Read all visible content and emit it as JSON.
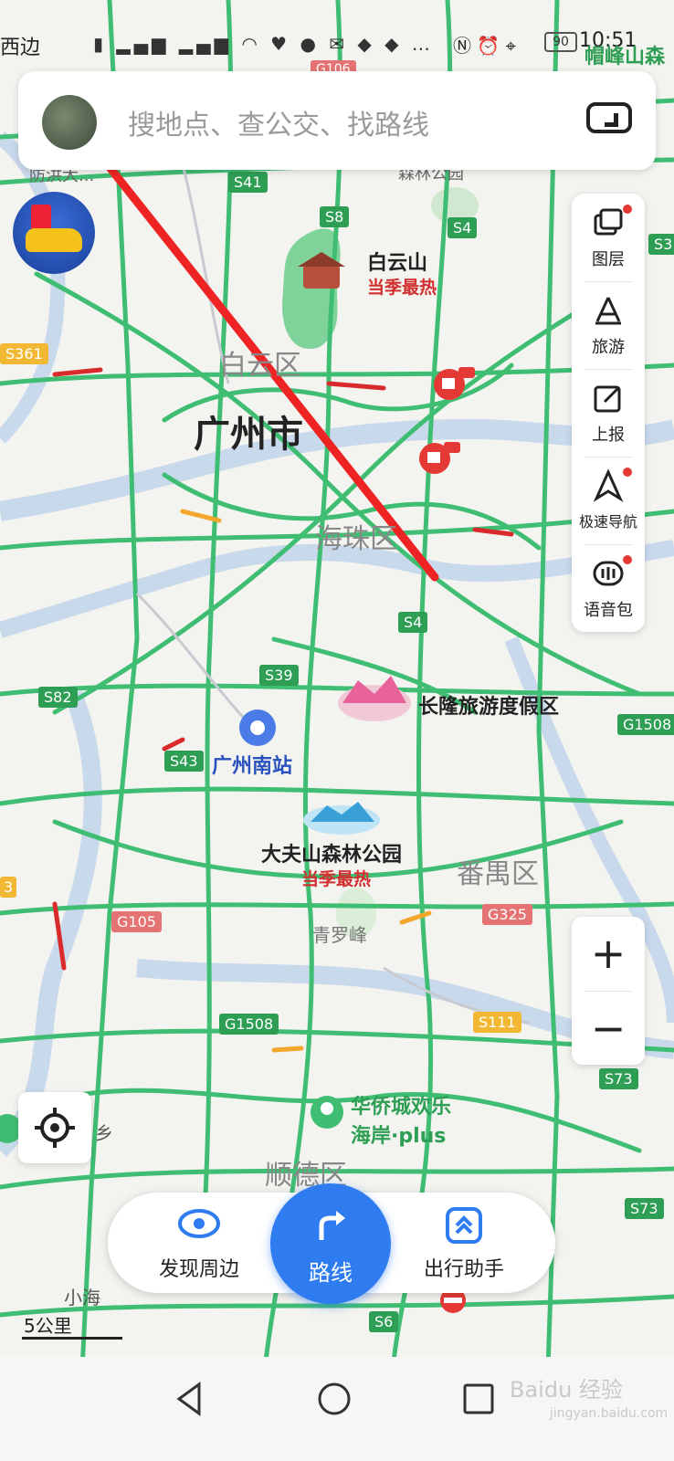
{
  "status_bar": {
    "left_text": "西边",
    "time": "10:51",
    "battery": "90",
    "right_place": "帽峰山森"
  },
  "search": {
    "placeholder": "搜地点、查公交、找路线"
  },
  "side_panel": {
    "items": [
      {
        "label": "图层",
        "icon": "layers-icon",
        "badge": true
      },
      {
        "label": "旅游",
        "icon": "travel-icon",
        "badge": false
      },
      {
        "label": "上报",
        "icon": "report-icon",
        "badge": false
      },
      {
        "label": "极速导航",
        "icon": "navigation-icon",
        "badge": true
      },
      {
        "label": "语音包",
        "icon": "voice-pack-icon",
        "badge": true
      }
    ]
  },
  "zoom": {
    "in": "+",
    "out": "−"
  },
  "bottom_bar": {
    "discover": "发现周边",
    "route": "路线",
    "assistant": "出行助手"
  },
  "scale": {
    "label": "5公里"
  },
  "map": {
    "labels": {
      "baiyunshan": "白云山",
      "baiyunshan_tag": "当季最热",
      "baiyun_district": "白云区",
      "guangzhou": "广州市",
      "haizhu": "海珠区",
      "changlong": "长隆旅游度假区",
      "south_station": "广州南站",
      "dafushan": "大夫山森林公园",
      "dafushan_tag": "当季最热",
      "panyu": "番禺区",
      "qingluofeng": "青罗峰",
      "huaqiao_line1": "华侨城欢乐",
      "huaqiao_line2": "海岸·plus",
      "shunde": "顺德区",
      "xiaohai": "小海",
      "xiang": "乡",
      "fanghong": "防洪大...",
      "senlin_top": "森林公园"
    },
    "road_shields": {
      "s41": "S41",
      "s8": "S8",
      "s4a": "S4",
      "s4b": "S4",
      "s361": "S361",
      "s39": "S39",
      "s82": "S82",
      "s43": "S43",
      "g1508a": "G1508",
      "g1508b": "G1508",
      "g105": "G105",
      "g325": "G325",
      "s111": "S111",
      "s73a": "S73",
      "s73b": "S73",
      "s6": "S6",
      "g106": "G106",
      "s3": "S3",
      "s3b": "3"
    }
  },
  "watermark": {
    "line1": "Baidu 经验",
    "line2": "jingyan.baidu.com"
  }
}
